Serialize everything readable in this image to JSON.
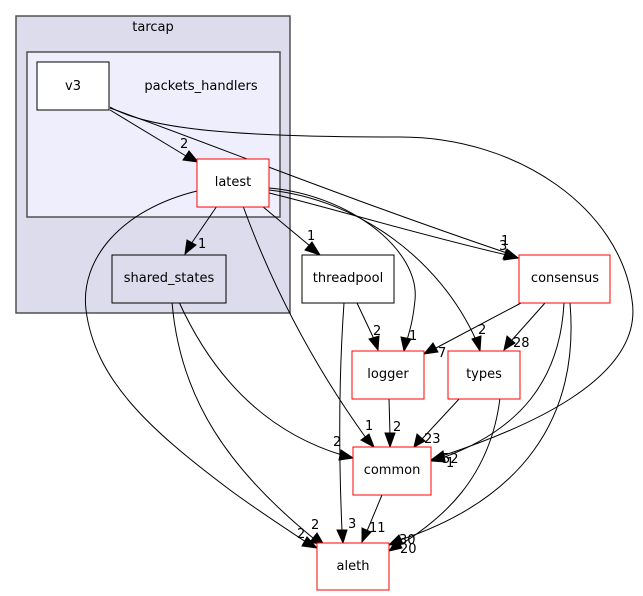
{
  "diagram": {
    "clusters": {
      "tarcap": {
        "label": "tarcap",
        "fill": "#dcdcec",
        "stroke": "#505050"
      },
      "packets_handlers": {
        "label": "packets_handlers",
        "fill": "#eeeefc",
        "stroke": "#505050"
      }
    },
    "nodes": {
      "v3": {
        "label": "v3",
        "border": "#000000",
        "fill": "#ffffff"
      },
      "latest": {
        "label": "latest",
        "border": "#ff0000",
        "fill": "#ffffff"
      },
      "shared_states": {
        "label": "shared_states",
        "border": "#000000",
        "fill": "#dcdcec"
      },
      "threadpool": {
        "label": "threadpool",
        "border": "#000000",
        "fill": "#ffffff"
      },
      "consensus": {
        "label": "consensus",
        "border": "#ff0000",
        "fill": "#ffffff"
      },
      "logger": {
        "label": "logger",
        "border": "#ff0000",
        "fill": "#ffffff"
      },
      "types": {
        "label": "types",
        "border": "#ff0000",
        "fill": "#ffffff"
      },
      "common": {
        "label": "common",
        "border": "#ff0000",
        "fill": "#ffffff"
      },
      "aleth": {
        "label": "aleth",
        "border": "#ff0000",
        "fill": "#ffffff"
      }
    },
    "edges": [
      {
        "from": "v3",
        "to": "latest",
        "label": "2"
      },
      {
        "from": "v3",
        "to": "consensus",
        "label": "3"
      },
      {
        "from": "v3",
        "to": "common",
        "label": "1"
      },
      {
        "from": "latest",
        "to": "shared_states",
        "label": "1"
      },
      {
        "from": "latest",
        "to": "threadpool",
        "label": "1"
      },
      {
        "from": "latest",
        "to": "consensus",
        "label": "1"
      },
      {
        "from": "latest",
        "to": "logger",
        "label": "1"
      },
      {
        "from": "latest",
        "to": "types",
        "label": "2"
      },
      {
        "from": "latest",
        "to": "common",
        "label": "1"
      },
      {
        "from": "latest",
        "to": "aleth",
        "label": "2"
      },
      {
        "from": "shared_states",
        "to": "common",
        "label": "2"
      },
      {
        "from": "shared_states",
        "to": "aleth",
        "label": "2"
      },
      {
        "from": "threadpool",
        "to": "logger",
        "label": "2"
      },
      {
        "from": "threadpool",
        "to": "aleth",
        "label": "3"
      },
      {
        "from": "consensus",
        "to": "logger",
        "label": "7"
      },
      {
        "from": "consensus",
        "to": "types",
        "label": "28"
      },
      {
        "from": "consensus",
        "to": "common",
        "label": "52"
      },
      {
        "from": "consensus",
        "to": "aleth",
        "label": "30"
      },
      {
        "from": "logger",
        "to": "common",
        "label": "2"
      },
      {
        "from": "types",
        "to": "common",
        "label": "23"
      },
      {
        "from": "types",
        "to": "aleth",
        "label": "20"
      },
      {
        "from": "common",
        "to": "aleth",
        "label": "11"
      }
    ]
  }
}
